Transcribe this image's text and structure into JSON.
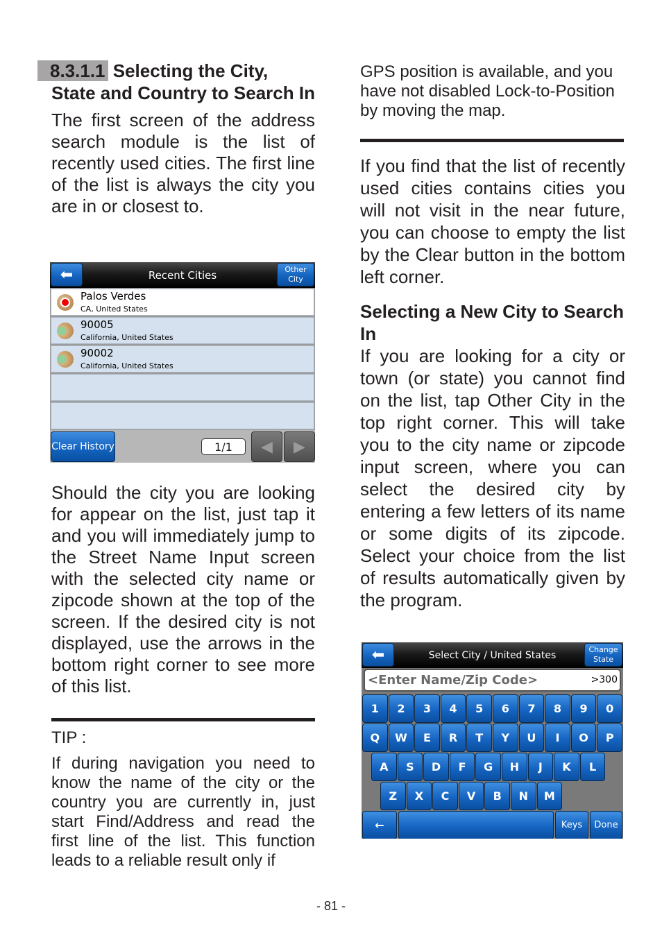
{
  "left_column": {
    "section_number": "8.3.1.1",
    "section_title": "Selecting the City, State and Country to Search In",
    "para1": "The first screen of the address search module is the list of recently used cities. The first line of the list is always the city you are in or closest to.",
    "para2": "Should the city you are looking for appear on the list, just tap it and you will immediately jump to the Street Name Input screen with the selected city name or zipcode shown at the top of the screen. If the desired city is not displayed, use the arrows in the bottom right corner to see more of this list.",
    "tip_label": "TIP :",
    "tip_text": "If during navigation you need to know the name of the city or the country you are currently in, just start Find/Address and read the first line of the list. This function leads to a reliable result only if"
  },
  "right_column": {
    "tip_continuation": "GPS position is available, and you have not disabled Lock-to-Position by moving the map.",
    "para1": "If you find that the list of recently used cities contains cities you will not visit in the near future, you can choose to empty the list by the Clear button in the bottom left corner.",
    "subheading": "Selecting a New City to Search In",
    "para2": "If you are looking for a city or town (or state) you cannot find on the list, tap Other City in the top right corner. This will take you to the city name or zipcode input screen, where you can select the desired city by entering a few letters of its name or some digits of its zipcode. Select your choice from the list of results automatically given by the program."
  },
  "recent_cities_screen": {
    "title": "Recent Cities",
    "back_icon": "left-arrow-icon",
    "other_city_line1": "Other",
    "other_city_line2": "City",
    "items": [
      {
        "name": "Palos Verdes",
        "location": "CA, United States",
        "icon": "gps-position-icon"
      },
      {
        "name": "90005",
        "location": "California, United States",
        "icon": "city-map-icon"
      },
      {
        "name": "90002",
        "location": "California, United States",
        "icon": "city-map-icon"
      },
      {
        "name": "",
        "location": ""
      },
      {
        "name": "",
        "location": ""
      }
    ],
    "clear_history": "Clear History",
    "page_indicator": "1/1",
    "prev_icon": "◀",
    "next_icon": "▶"
  },
  "select_city_screen": {
    "title": "Select City / United States",
    "change_state_line1": "Change",
    "change_state_line2": "State",
    "input_placeholder": "<Enter Name/Zip Code>",
    "result_count": ">300",
    "rows": [
      [
        "1",
        "2",
        "3",
        "4",
        "5",
        "6",
        "7",
        "8",
        "9",
        "0"
      ],
      [
        "Q",
        "W",
        "E",
        "R",
        "T",
        "Y",
        "U",
        "I",
        "O",
        "P"
      ],
      [
        "A",
        "S",
        "D",
        "F",
        "G",
        "H",
        "J",
        "K",
        "L"
      ],
      [
        "Z",
        "X",
        "C",
        "V",
        "B",
        "N",
        "M"
      ]
    ],
    "backspace": "←",
    "keys_label": "Keys",
    "done_label": "Done"
  },
  "page_number": "- 81 -"
}
